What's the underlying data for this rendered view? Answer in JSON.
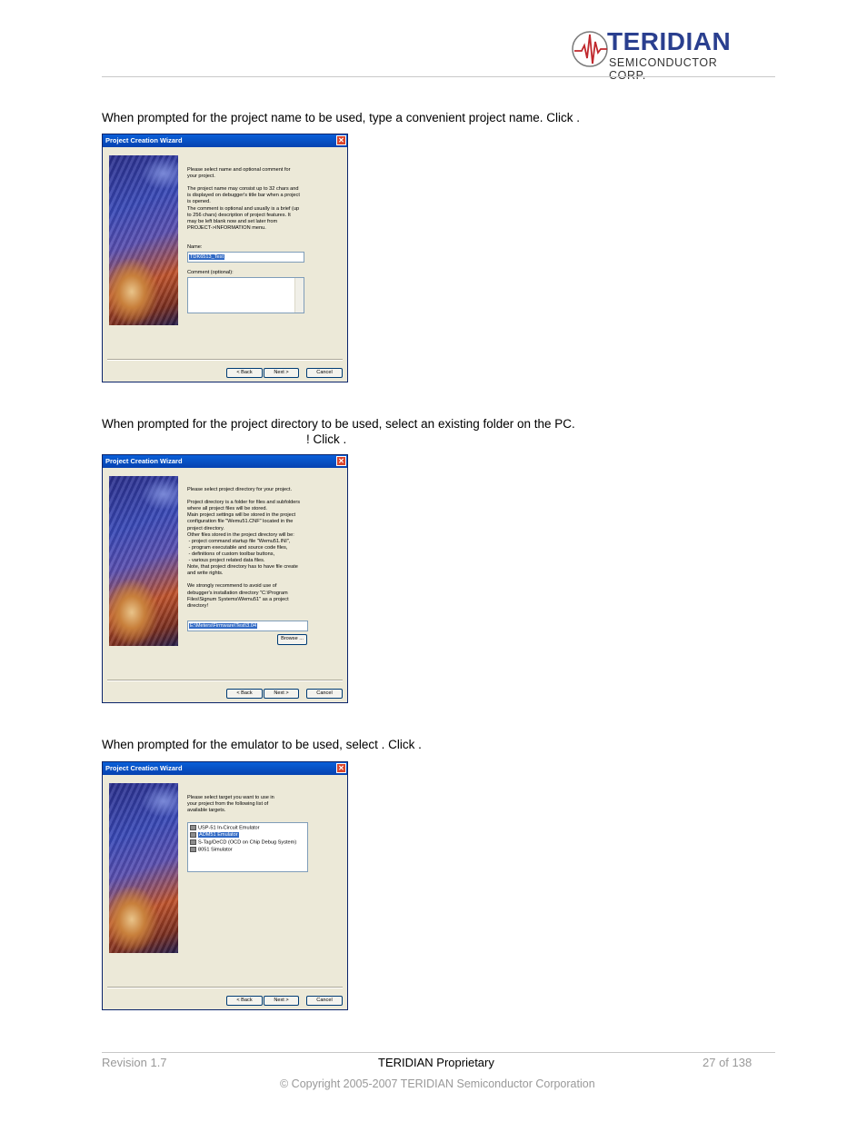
{
  "header": {
    "brand": "TERIDIAN",
    "subtitle": "SEMICONDUCTOR CORP."
  },
  "steps": [
    {
      "text": "When prompted for the project name to be used, type a convenient project name. Click        ."
    },
    {
      "line1": "When prompted for the project directory to be used, select an existing folder on the PC.",
      "line2": "! Click        ."
    },
    {
      "text": "When prompted for the emulator to be used, select                        . Click        ."
    }
  ],
  "wizard1": {
    "title": "Project Creation Wizard",
    "intro": "Please select name and optional comment for\nyour project.\n\nThe project name may consist up to 32 chars and\nis displayed on debugger's title bar when a project\nis opened.\nThe comment is optional and usually is a brief (up\nto 256 chars) description of project features. It\nmay be left blank now and set later from\nPROJECT->INFORMATION menu.",
    "name_label": "Name:",
    "name_value": "TDK6513_Test",
    "comment_label": "Comment (optional):",
    "back": "< Back",
    "next": "Next >",
    "cancel": "Cancel"
  },
  "wizard2": {
    "title": "Project Creation Wizard",
    "intro": "Please select project directory for your project.\n\nProject directory is a folder for files and subfolders\nwhere all project files will be stored.\nMain project settings will be stored in the project\nconfiguration file \"Wemu51.CNF\" located in the\nproject directory.\nOther files stored in the project directory will be:\n - project command startup file \"Wemu51.INI\",\n - program executable and source code files,\n - definitions of custom toolbar buttons,\n - various project related data files.\nNote, that project directory has to have file create\nand write rights.\n\nWe strongly recommend to avoid use of\ndebugger's installation directory \"C:\\Program\nFiles\\Signum Systems\\Wemu51\" as a project\ndirectory!",
    "dir_value": "E:\\Meters\\Firmware\\Test\\3.04",
    "browse": "Browse ...",
    "back": "< Back",
    "next": "Next >",
    "cancel": "Cancel"
  },
  "wizard3": {
    "title": "Project Creation Wizard",
    "intro": "Please select target you want to use in\nyour project from the following list of\navailable targets.",
    "targets": [
      "USP-51 In-Circuit Emulator",
      "ADM51 Emulator",
      "S-Tag/DeCD (OCD on Chip Debug System)",
      "8051 Simulator"
    ],
    "selected_index": 1,
    "back": "< Back",
    "next": "Next >",
    "cancel": "Cancel"
  },
  "footer": {
    "revision": "Revision 1.7",
    "proprietary": "TERIDIAN Proprietary",
    "page": "27 of 138",
    "copyright": "© Copyright 2005-2007 TERIDIAN Semiconductor Corporation"
  }
}
